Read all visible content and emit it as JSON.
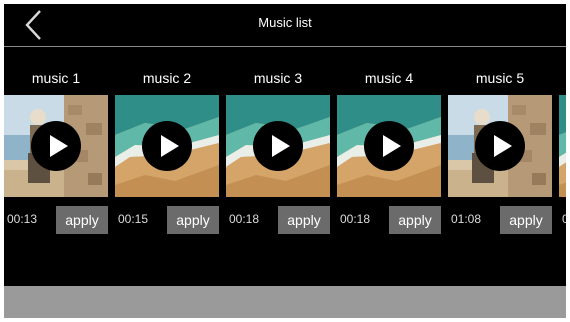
{
  "header": {
    "title": "Music list",
    "back_icon": "chevron-left-icon"
  },
  "music_items": [
    {
      "label": "music 1",
      "duration": "00:13",
      "apply_label": "apply",
      "thumbnail": "person-by-stone-wall"
    },
    {
      "label": "music 2",
      "duration": "00:15",
      "apply_label": "apply",
      "thumbnail": "aerial-beach-coast"
    },
    {
      "label": "music 3",
      "duration": "00:18",
      "apply_label": "apply",
      "thumbnail": "aerial-beach-coast"
    },
    {
      "label": "music 4",
      "duration": "00:18",
      "apply_label": "apply",
      "thumbnail": "aerial-beach-coast"
    },
    {
      "label": "music 5",
      "duration": "01:08",
      "apply_label": "apply",
      "thumbnail": "person-by-stone-wall"
    },
    {
      "label": "",
      "duration": "0",
      "apply_label": "",
      "thumbnail": "aerial-beach-coast"
    }
  ],
  "colors": {
    "background": "#000000",
    "apply_button": "#6b6b6b",
    "bottom_bar": "#9a9a9a",
    "divider": "#8a8a8a"
  }
}
